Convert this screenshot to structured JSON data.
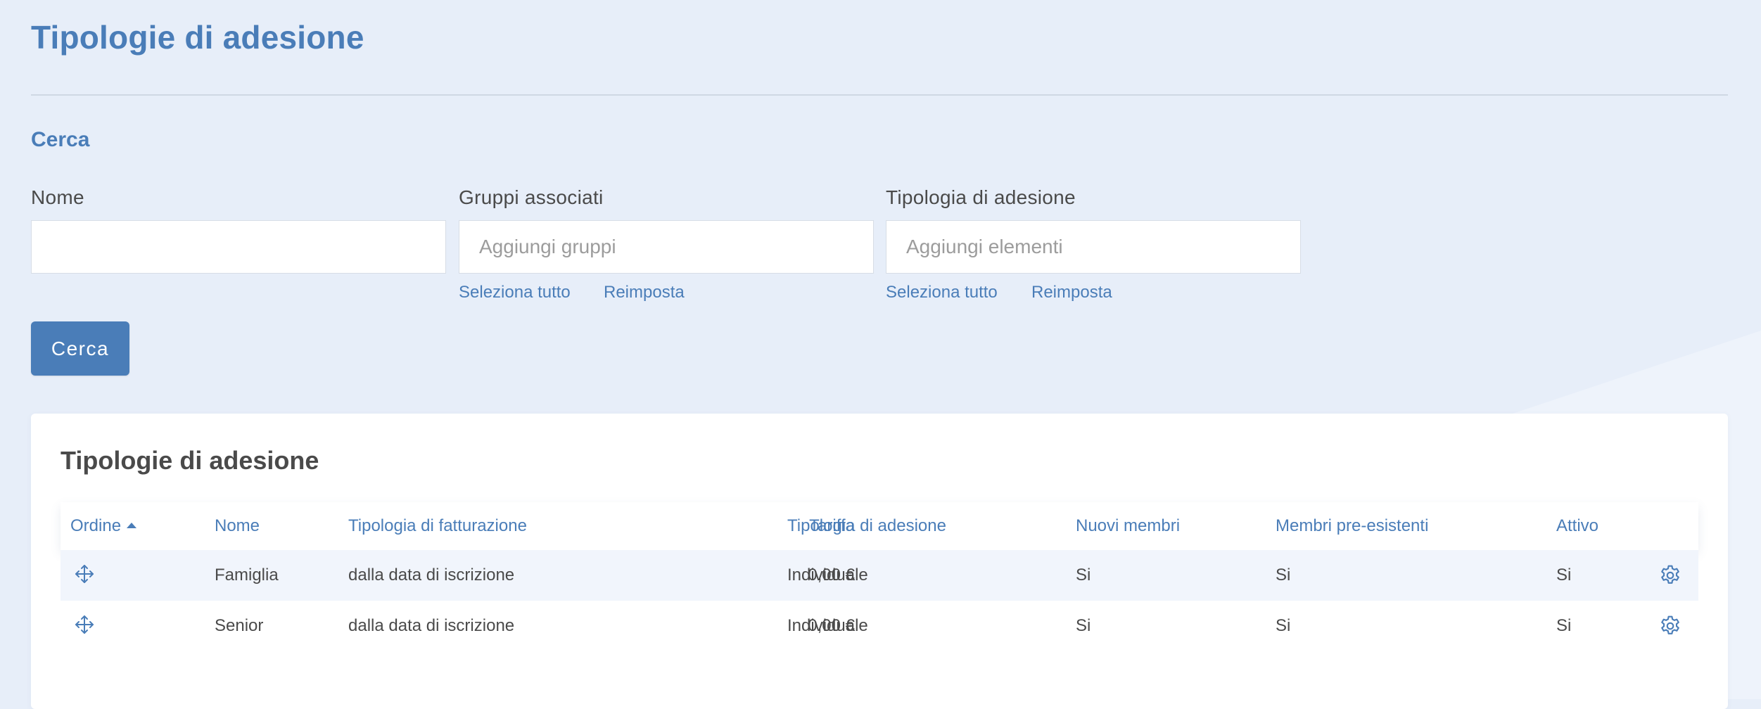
{
  "page": {
    "title": "Tipologie di adesione"
  },
  "search": {
    "section_title": "Cerca",
    "fields": [
      {
        "label": "Nome",
        "value": "",
        "placeholder": ""
      },
      {
        "label": "Gruppi associati",
        "value": "",
        "placeholder": "Aggiungi gruppi"
      },
      {
        "label": "Tipologia di adesione",
        "value": "",
        "placeholder": "Aggiungi elementi"
      }
    ],
    "select_all_label": "Seleziona tutto",
    "reset_label": "Reimposta",
    "button_label": "Cerca"
  },
  "table": {
    "title": "Tipologie di adesione",
    "sort_column": "Ordine",
    "sort_direction": "ascending",
    "columns": [
      "Ordine",
      "Nome",
      "Tipologia di fatturazione",
      "Tariffa",
      "Tipologia di adesione",
      "Nuovi membri",
      "Membri pre-esistenti",
      "Attivo"
    ],
    "rows": [
      {
        "order_icon": "move-icon",
        "nome": "Famiglia",
        "fatturazione": "dalla data di iscrizione",
        "tariffa": "0,00 €",
        "tipologia": "Individuale",
        "nuovi": "Si",
        "pre_esistenti": "Si",
        "attivo": "Si",
        "action_icon": "gear-icon"
      },
      {
        "order_icon": "move-icon",
        "nome": "Senior",
        "fatturazione": "dalla data di iscrizione",
        "tariffa": "0,00 €",
        "tipologia": "Individuale",
        "nuovi": "Si",
        "pre_esistenti": "Si",
        "attivo": "Si",
        "action_icon": "gear-icon"
      }
    ]
  },
  "colors": {
    "accent": "#4a7db8",
    "background": "#e7eef9",
    "card": "#ffffff",
    "row_highlight": "#f1f5fc",
    "text": "#4a4a4a"
  }
}
